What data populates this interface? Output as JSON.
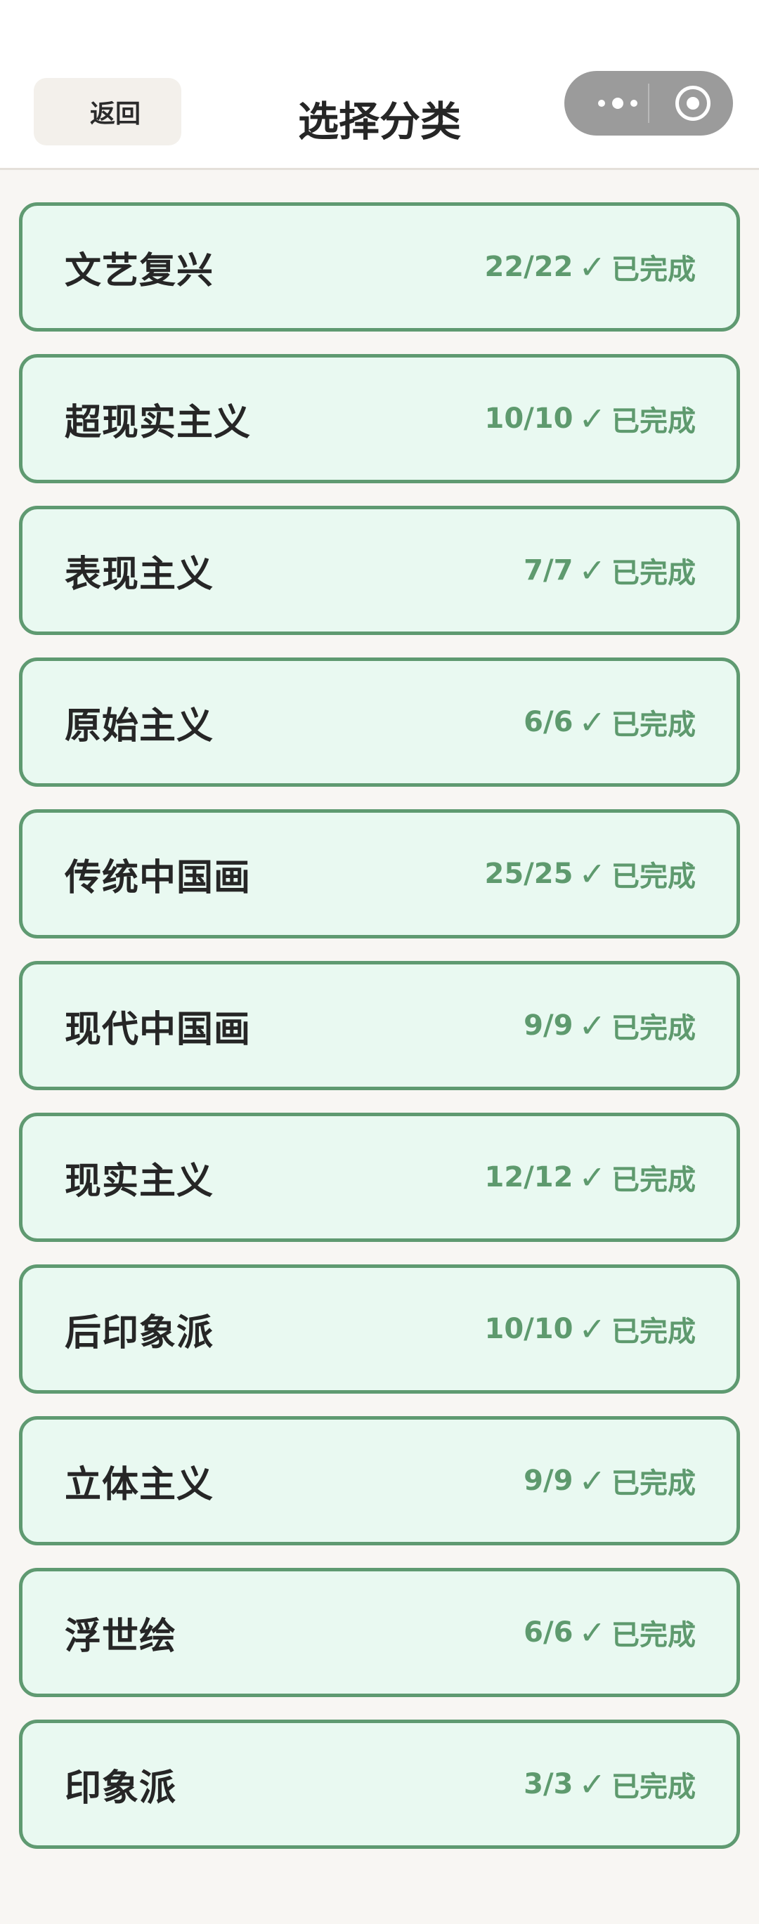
{
  "header": {
    "back_label": "返回",
    "title": "选择分类"
  },
  "capsule": {
    "menu_icon": "more-dots-icon",
    "close_icon": "target-circle-icon"
  },
  "colors": {
    "card_background": "#e9f9f1",
    "card_border": "#5f9a71",
    "status_text": "#5e9a6e"
  },
  "categories": [
    {
      "name": "文艺复兴",
      "progress": "22/22",
      "check": "✓",
      "status": "已完成"
    },
    {
      "name": "超现实主义",
      "progress": "10/10",
      "check": "✓",
      "status": "已完成"
    },
    {
      "name": "表现主义",
      "progress": "7/7",
      "check": "✓",
      "status": "已完成"
    },
    {
      "name": "原始主义",
      "progress": "6/6",
      "check": "✓",
      "status": "已完成"
    },
    {
      "name": "传统中国画",
      "progress": "25/25",
      "check": "✓",
      "status": "已完成"
    },
    {
      "name": "现代中国画",
      "progress": "9/9",
      "check": "✓",
      "status": "已完成"
    },
    {
      "name": "现实主义",
      "progress": "12/12",
      "check": "✓",
      "status": "已完成"
    },
    {
      "name": "后印象派",
      "progress": "10/10",
      "check": "✓",
      "status": "已完成"
    },
    {
      "name": "立体主义",
      "progress": "9/9",
      "check": "✓",
      "status": "已完成"
    },
    {
      "name": "浮世绘",
      "progress": "6/6",
      "check": "✓",
      "status": "已完成"
    },
    {
      "name": "印象派",
      "progress": "3/3",
      "check": "✓",
      "status": "已完成"
    }
  ]
}
